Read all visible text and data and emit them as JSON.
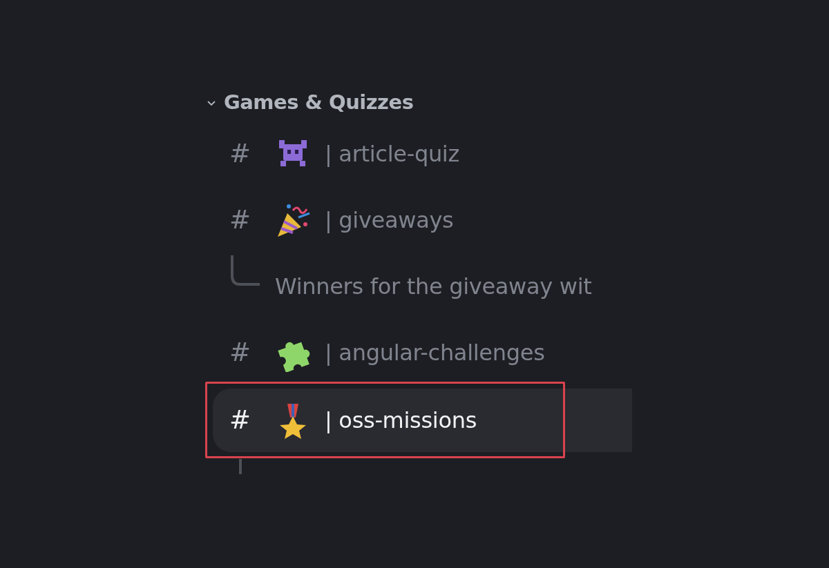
{
  "category": {
    "title": "Games & Quizzes",
    "expanded": true
  },
  "channels": [
    {
      "hash": "#",
      "name": "| article-quiz",
      "selected": false,
      "highlighted": false
    },
    {
      "hash": "#",
      "name": "| giveaways",
      "selected": false,
      "highlighted": false,
      "threads": [
        {
          "title": "Winners for the giveaway wit"
        }
      ]
    },
    {
      "hash": "#",
      "name": "| angular-challenges",
      "selected": false,
      "highlighted": false
    },
    {
      "hash": "#",
      "name": "| oss-missions",
      "selected": true,
      "highlighted": true
    }
  ]
}
